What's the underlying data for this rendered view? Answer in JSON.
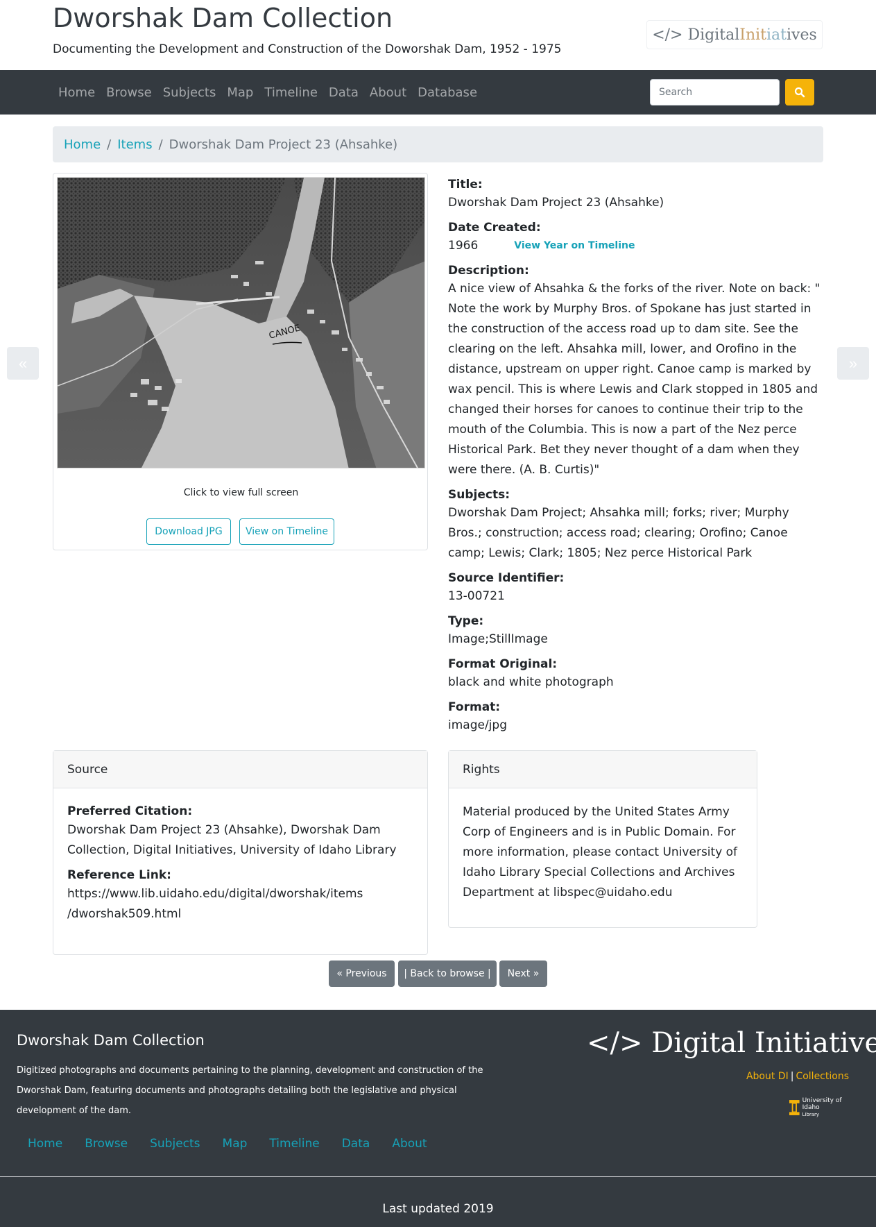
{
  "header": {
    "title": "Dworshak Dam Collection",
    "subtitle": "Documenting the Development and Construction of the Doworshak Dam, 1952 - 1975",
    "logo_text_1": "</> Digital ",
    "logo_text_2": "Init",
    "logo_text_3": "iat",
    "logo_text_4": "ives"
  },
  "nav": {
    "items": [
      "Home",
      "Browse",
      "Subjects",
      "Map",
      "Timeline",
      "Data",
      "About",
      "Database"
    ],
    "search_placeholder": "Search",
    "search_icon": "search-icon"
  },
  "breadcrumb": {
    "home": "Home",
    "items": "Items",
    "current": "Dworshak Dam Project 23 (Ahsahke)"
  },
  "arrows": {
    "prev": "«",
    "next": "»"
  },
  "image": {
    "caption": "Click to view full screen",
    "download_label": "Download JPG",
    "timeline_label": "View on Timeline",
    "annotation": "CANOE"
  },
  "metadata": {
    "title_label": "Title:",
    "title_value": "Dworshak Dam Project 23 (Ahsahke)",
    "date_label": "Date Created:",
    "date_value": "1966",
    "date_link": "View Year on Timeline",
    "description_label": "Description:",
    "description_value": "A nice view of Ahsahka & the forks of the river. Note on back: \" Note the work by Murphy Bros. of Spokane has just started in the construction of the access road up to dam site. See the clearing on the left. Ahsahka mill, lower, and Orofino in the distance, upstream on upper right. Canoe camp is marked by wax pencil. This is where Lewis and Clark stopped in 1805 and changed their horses for canoes to continue their trip to the mouth of the Columbia. This is now a part of the Nez perce Historical Park. Bet they never thought of a dam when they were there. (A. B. Curtis)\"",
    "subjects_label": "Subjects:",
    "subjects_value": "Dworshak Dam Project; Ahsahka mill; forks; river; Murphy Bros.; construction; access road; clearing; Orofino; Canoe camp; Lewis; Clark; 1805; Nez perce Historical Park",
    "identifier_label": "Source Identifier:",
    "identifier_value": "13-00721",
    "type_label": "Type:",
    "type_value": "Image;StillImage",
    "format_original_label": "Format Original:",
    "format_original_value": "black and white photograph",
    "format_label": "Format:",
    "format_value": "image/jpg"
  },
  "source": {
    "header": "Source",
    "citation_label": "Preferred Citation:",
    "citation_value": "Dworshak Dam Project 23 (Ahsahke), Dworshak Dam Collection, Digital Initiatives, University of Idaho Library",
    "reference_label": "Reference Link:",
    "reference_line_1": "https://www.lib.uidaho.edu/digital/dworshak/items",
    "reference_line_2": "/dworshak509.html"
  },
  "rights": {
    "header": "Rights",
    "text": "Material produced by the United States Army Corp of Engineers and is in Public Domain. For more information, please contact University of Idaho Library Special Collections and Archives Department at libspec@uidaho.edu"
  },
  "pager": {
    "previous": "« Previous",
    "back": "| Back to browse |",
    "next": "Next »"
  },
  "footer": {
    "title": "Dworshak Dam Collection",
    "description": "Digitized photographs and documents pertaining to the planning, development and construction of the Dworshak Dam, featuring documents and photographs detailing both the legislative and physical development of the dam.",
    "di_logo": "</> Digital Initiatives",
    "about_di": "About DI",
    "separator": "|",
    "collections": "Collections",
    "uidaho_line_1": "University of Idaho",
    "uidaho_line_2": "Library",
    "nav": [
      "Home",
      "Browse",
      "Subjects",
      "Map",
      "Timeline",
      "Data",
      "About"
    ],
    "updated": "Last updated 2019"
  },
  "colors": {
    "accent": "#17a2b8",
    "navbar": "#343a40",
    "search_button": "#f5b30a",
    "pager": "#6c757d"
  }
}
